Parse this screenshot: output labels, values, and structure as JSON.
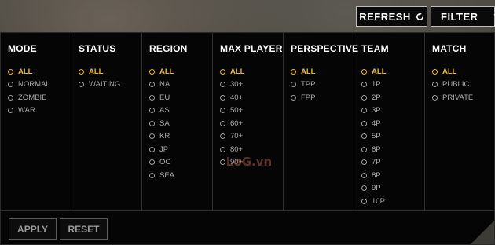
{
  "top_buttons": {
    "refresh_label": "REFRESH",
    "filter_label": "FILTER"
  },
  "icons": {
    "refresh": "refresh-icon",
    "filter_caret": "caret-down-icon"
  },
  "accent_color": "#f0b90b",
  "columns": [
    {
      "title": "MODE",
      "selected": "ALL",
      "options": [
        "ALL",
        "NORMAL",
        "ZOMBIE",
        "WAR"
      ]
    },
    {
      "title": "STATUS",
      "selected": "ALL",
      "options": [
        "ALL",
        "WAITING"
      ]
    },
    {
      "title": "REGION",
      "selected": "ALL",
      "options": [
        "ALL",
        "NA",
        "EU",
        "AS",
        "SA",
        "KR",
        "JP",
        "OC",
        "SEA"
      ]
    },
    {
      "title": "MAX PLAYER",
      "selected": "ALL",
      "options": [
        "ALL",
        "30+",
        "40+",
        "50+",
        "60+",
        "70+",
        "80+",
        "90+"
      ]
    },
    {
      "title": "PERSPECTIVE",
      "selected": "ALL",
      "options": [
        "ALL",
        "TPP",
        "FPP"
      ]
    },
    {
      "title": "TEAM",
      "selected": "ALL",
      "options": [
        "ALL",
        "1P",
        "2P",
        "3P",
        "4P",
        "5P",
        "6P",
        "7P",
        "8P",
        "9P",
        "10P"
      ]
    },
    {
      "title": "MATCH",
      "selected": "ALL",
      "options": [
        "ALL",
        "PUBLIC",
        "PRIVATE"
      ]
    }
  ],
  "bottom_buttons": {
    "apply_label": "APPLY",
    "reset_label": "RESET"
  },
  "watermark": "LoG.vn"
}
